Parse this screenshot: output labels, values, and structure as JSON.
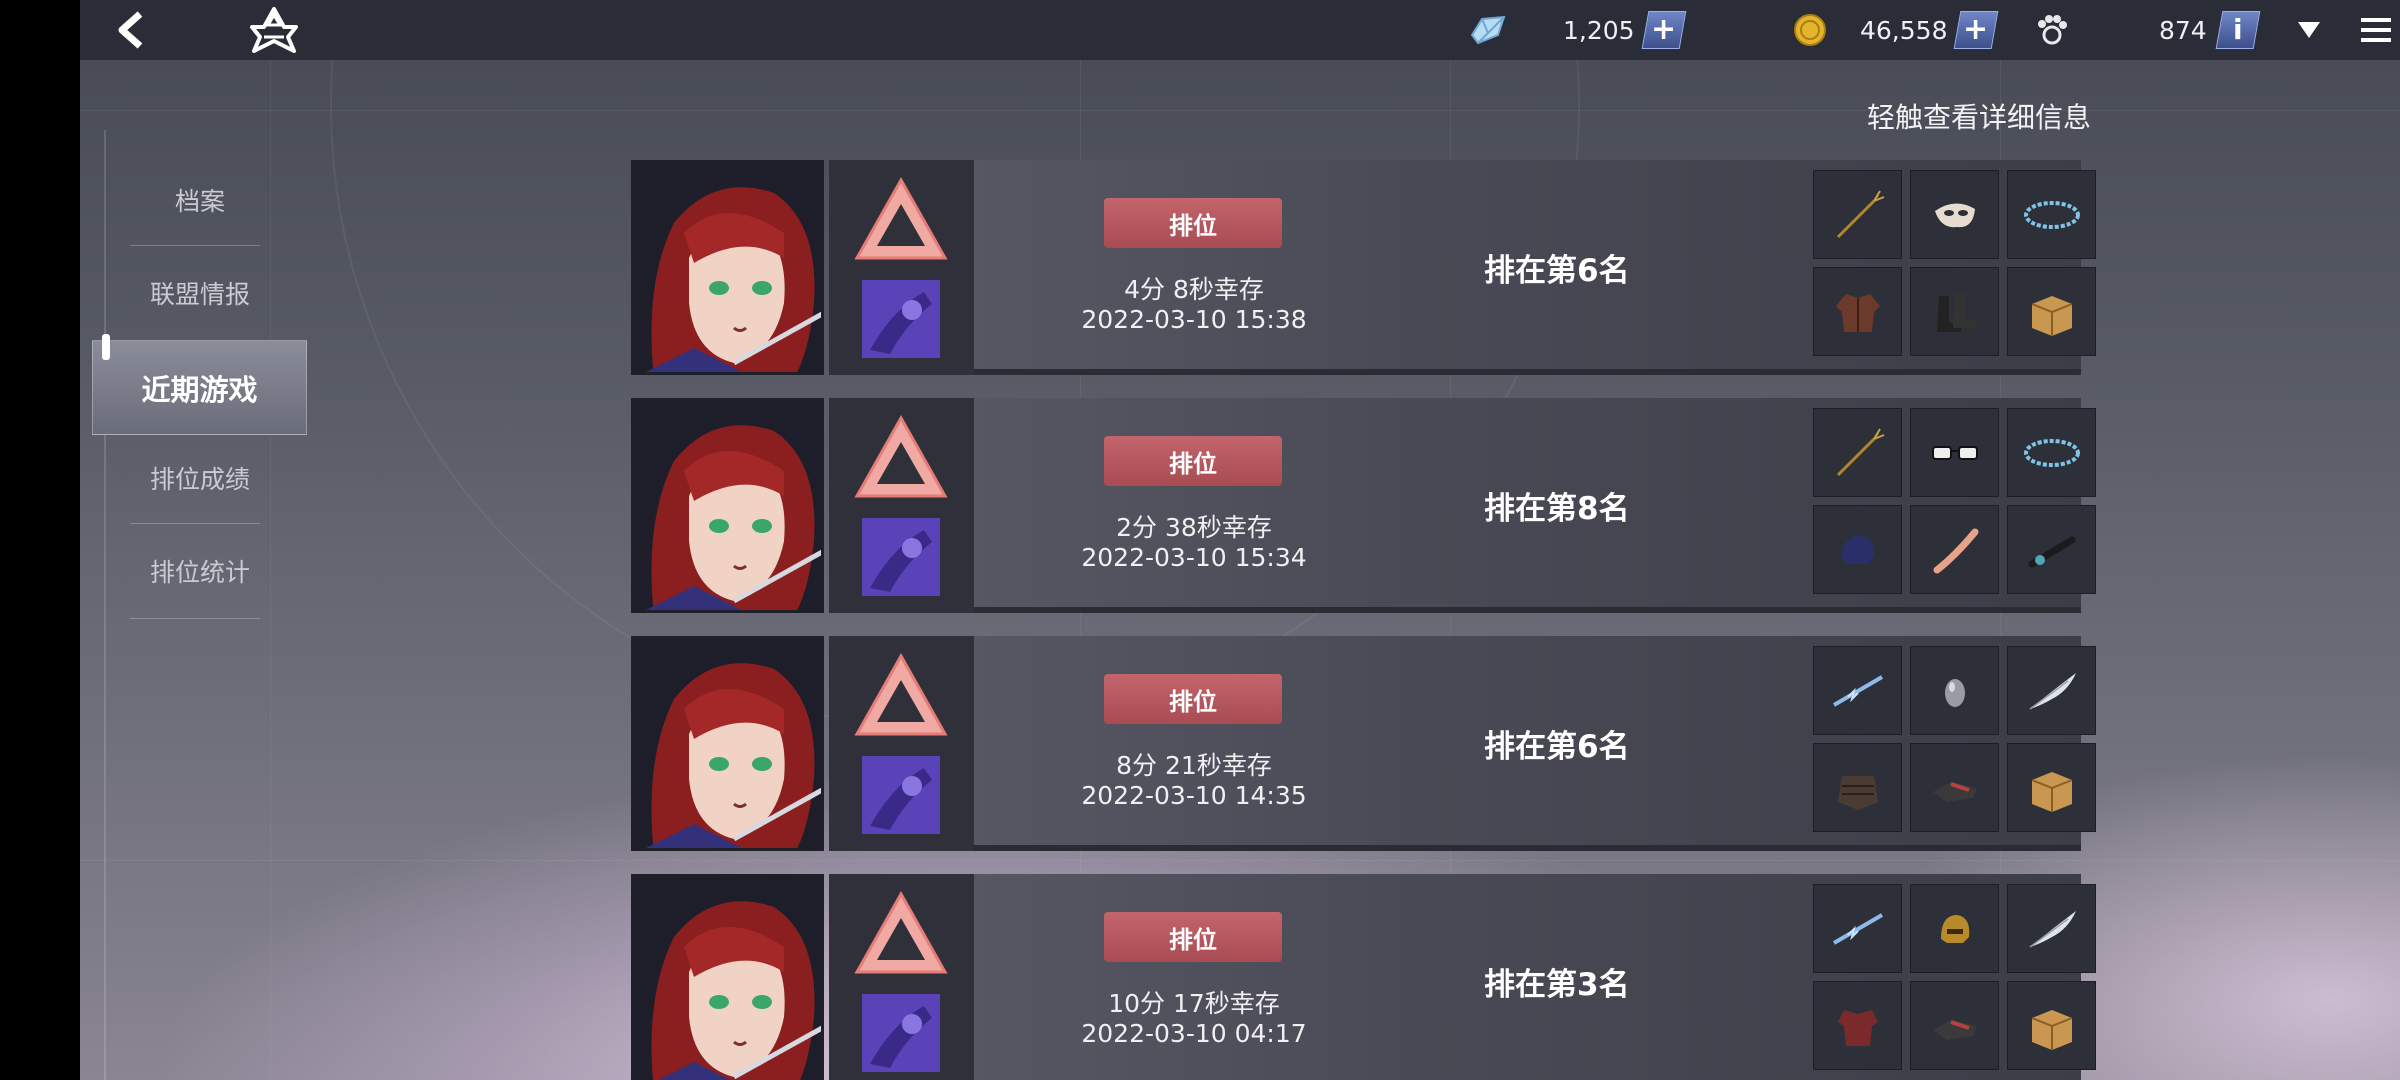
{
  "topbar": {
    "back_icon": "back-arrow-icon",
    "emblem_icon": "star-emblem-icon",
    "currencies": [
      {
        "icon": "crystal-icon",
        "value": "1,205",
        "has_plus": true
      },
      {
        "icon": "gold-coin-icon",
        "value": "46,558",
        "has_plus": true
      },
      {
        "icon": "paw-icon",
        "value": "874",
        "has_info": true,
        "info_label": "i"
      }
    ],
    "dropdown_icon": "dropdown-triangle-icon",
    "menu_icon": "hamburger-menu-icon"
  },
  "sidebar": {
    "items": [
      {
        "label": "档案"
      },
      {
        "label": "联盟情报"
      },
      {
        "label": "近期游戏",
        "active": true
      },
      {
        "label": "排位成绩"
      },
      {
        "label": "排位统计"
      }
    ]
  },
  "hint": "轻触查看详细信息",
  "matches": [
    {
      "mode": "排位",
      "survival": "4分 8秒幸存",
      "datetime": "2022-03-10 15:38",
      "rank": "排在第6名",
      "items": [
        "trident-icon",
        "mask-icon",
        "bracelet-icon",
        "jacket-icon",
        "boots-icon",
        "box-icon"
      ]
    },
    {
      "mode": "排位",
      "survival": "2分 38秒幸存",
      "datetime": "2022-03-10 15:34",
      "rank": "排在第8名",
      "items": [
        "trident-icon",
        "glasses-icon",
        "bracelet-icon",
        "helmet-icon",
        "arm-icon",
        "scope-icon"
      ]
    },
    {
      "mode": "排位",
      "survival": "8分 21秒幸存",
      "datetime": "2022-03-10 14:35",
      "rank": "排在第6名",
      "items": [
        "lightning-spear-icon",
        "egg-icon",
        "feather-icon",
        "armor-icon",
        "gauntlet-icon",
        "box-icon"
      ]
    },
    {
      "mode": "排位",
      "survival": "10分 17秒幸存",
      "datetime": "2022-03-10 04:17",
      "rank": "排在第3名",
      "items": [
        "lightning-spear-icon",
        "golden-helmet-icon",
        "feather-icon",
        "red-armor-icon",
        "gauntlet-icon",
        "box-icon"
      ]
    }
  ],
  "colors": {
    "accent_red": "#c4656c",
    "plus_button": "#4f63a8",
    "topbar": "#2a2d37"
  }
}
